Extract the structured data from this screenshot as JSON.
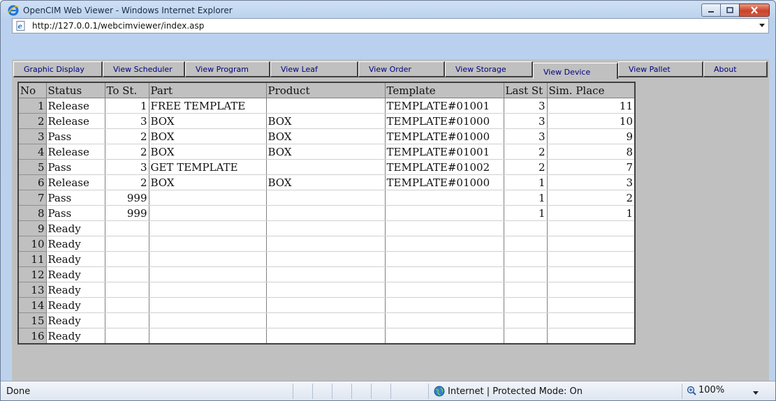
{
  "window": {
    "title": "OpenCIM Web Viewer - Windows Internet Explorer"
  },
  "address": {
    "url": "http://127.0.0.1/webcimviewer/index.asp"
  },
  "tabs": [
    {
      "label": "Graphic Display",
      "active": false
    },
    {
      "label": "View Scheduler",
      "active": false
    },
    {
      "label": "View Program",
      "active": false
    },
    {
      "label": "View Leaf",
      "active": false
    },
    {
      "label": "View Order",
      "active": false
    },
    {
      "label": "View Storage",
      "active": false
    },
    {
      "label": "View Device",
      "active": true
    },
    {
      "label": "View Pallet",
      "active": false
    },
    {
      "label": "About",
      "active": false
    }
  ],
  "table": {
    "columns": [
      "No",
      "Status",
      "To St.",
      "Part",
      "Product",
      "Template",
      "Last St",
      "Sim. Place"
    ],
    "rows": [
      [
        "1",
        "Release",
        "1",
        "FREE TEMPLATE",
        "",
        "TEMPLATE#01001",
        "3",
        "11"
      ],
      [
        "2",
        "Release",
        "3",
        "BOX",
        "BOX",
        "TEMPLATE#01000",
        "3",
        "10"
      ],
      [
        "3",
        "Pass",
        "2",
        "BOX",
        "BOX",
        "TEMPLATE#01000",
        "3",
        "9"
      ],
      [
        "4",
        "Release",
        "2",
        "BOX",
        "BOX",
        "TEMPLATE#01001",
        "2",
        "8"
      ],
      [
        "5",
        "Pass",
        "3",
        "GET TEMPLATE",
        "",
        "TEMPLATE#01002",
        "2",
        "7"
      ],
      [
        "6",
        "Release",
        "2",
        "BOX",
        "BOX",
        "TEMPLATE#01000",
        "1",
        "3"
      ],
      [
        "7",
        "Pass",
        "999",
        "",
        "",
        "",
        "1",
        "2"
      ],
      [
        "8",
        "Pass",
        "999",
        "",
        "",
        "",
        "1",
        "1"
      ],
      [
        "9",
        "Ready",
        "",
        "",
        "",
        "",
        "",
        ""
      ],
      [
        "10",
        "Ready",
        "",
        "",
        "",
        "",
        "",
        ""
      ],
      [
        "11",
        "Ready",
        "",
        "",
        "",
        "",
        "",
        ""
      ],
      [
        "12",
        "Ready",
        "",
        "",
        "",
        "",
        "",
        ""
      ],
      [
        "13",
        "Ready",
        "",
        "",
        "",
        "",
        "",
        ""
      ],
      [
        "14",
        "Ready",
        "",
        "",
        "",
        "",
        "",
        ""
      ],
      [
        "15",
        "Ready",
        "",
        "",
        "",
        "",
        "",
        ""
      ],
      [
        "16",
        "Ready",
        "",
        "",
        "",
        "",
        "",
        ""
      ]
    ]
  },
  "statusbar": {
    "text": "Done",
    "zone": "Internet | Protected Mode: On",
    "zoom": "100%"
  },
  "icons": {
    "browser": "ie-logo-icon",
    "page": "page-icon",
    "minimize": "minimize-icon",
    "maximize": "maximize-icon",
    "close": "close-icon",
    "zone": "globe-icon",
    "zoom": "zoom-icon"
  },
  "colors": {
    "tab_text": "#000080",
    "grid_header": "#c0c0c0",
    "close_button": "#c7452c"
  }
}
